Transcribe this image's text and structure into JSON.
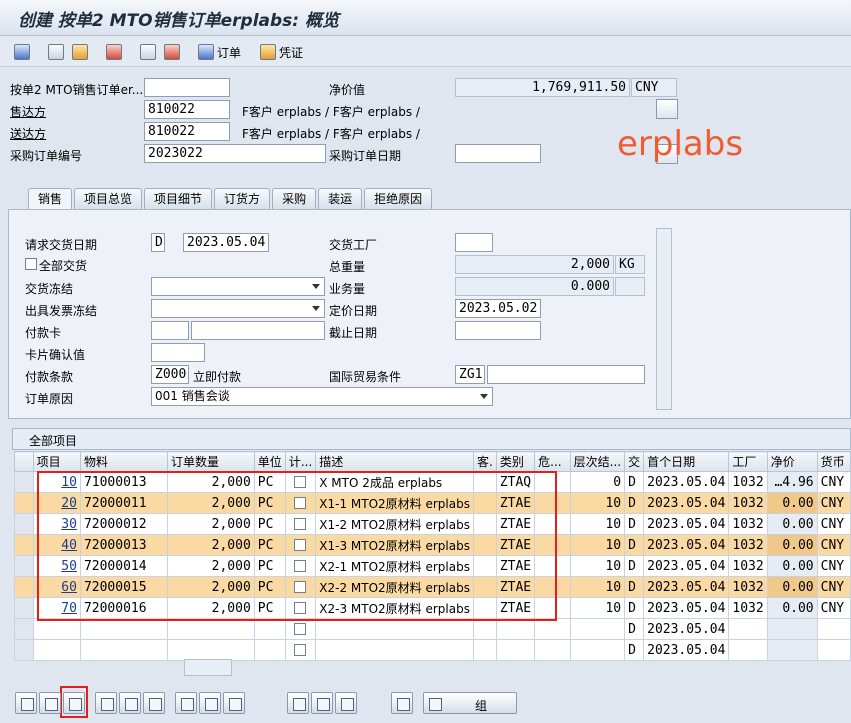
{
  "title": "创建 按单2 MTO销售订单erplabs: 概览",
  "toolbar": {
    "order_label": "订单",
    "voucher_label": "凭证"
  },
  "header": {
    "order_type_label": "按单2 MTO销售订单er...",
    "order_type_value": "",
    "net_value_label": "净价值",
    "net_value": "1,769,911.50",
    "currency": "CNY",
    "sold_to_label": "售达方",
    "sold_to_value": "810022",
    "sold_to_desc": "F客户 erplabs / F客户 erplabs /",
    "ship_to_label": "送达方",
    "ship_to_value": "810022",
    "ship_to_desc": "F客户 erplabs / F客户 erplabs /",
    "po_label": "采购订单编号",
    "po_value": "2023022",
    "po_date_label": "采购订单日期",
    "po_date_value": ""
  },
  "watermark": "erplabs",
  "tabs": [
    "销售",
    "项目总览",
    "项目细节",
    "订货方",
    "采购",
    "装运",
    "拒绝原因"
  ],
  "sales": {
    "req_delivery_label": "请求交货日期",
    "req_delivery_type": "D",
    "req_delivery_date": "2023.05.04",
    "delivery_plant_label": "交货工厂",
    "complete_delivery_label": "全部交货",
    "total_weight_label": "总重量",
    "total_weight": "2,000",
    "weight_unit": "KG",
    "delivery_block_label": "交货冻结",
    "volume_label": "业务量",
    "volume": "0.000",
    "billing_block_label": "出具发票冻结",
    "pricing_date_label": "定价日期",
    "pricing_date": "2023.05.02",
    "payment_card_label": "付款卡",
    "expiry_label": "截止日期",
    "card_verif_label": "卡片确认值",
    "payment_terms_label": "付款条款",
    "payment_terms_code": "Z000",
    "payment_terms_text": "立即付款",
    "incoterms_label": "国际贸易条件",
    "incoterms_code": "ZG1",
    "order_reason_label": "订单原因",
    "order_reason_value": "001 销售会谈"
  },
  "grid": {
    "title": "全部项目",
    "columns": [
      "项目",
      "物料",
      "订单数量",
      "单位",
      "计...",
      "描述",
      "客.",
      "类别",
      "危...",
      "层次结...",
      "交",
      "首个日期",
      "工厂",
      "净价",
      "货币"
    ],
    "rows": [
      {
        "item": "10",
        "material": "71000013",
        "qty": "2,000",
        "unit": "PC",
        "desc": "X MTO 2成品 erplabs",
        "cat": "ZTAQ",
        "hier": "0",
        "d": "D",
        "date": "2023.05.04",
        "plant": "1032",
        "price": "…4.96",
        "cur": "CNY"
      },
      {
        "item": "20",
        "material": "72000011",
        "qty": "2,000",
        "unit": "PC",
        "desc": "X1-1 MTO2原材料 erplabs",
        "cat": "ZTAE",
        "hier": "10",
        "d": "D",
        "date": "2023.05.04",
        "plant": "1032",
        "price": "0.00",
        "cur": "CNY"
      },
      {
        "item": "30",
        "material": "72000012",
        "qty": "2,000",
        "unit": "PC",
        "desc": "X1-2 MTO2原材料 erplabs",
        "cat": "ZTAE",
        "hier": "10",
        "d": "D",
        "date": "2023.05.04",
        "plant": "1032",
        "price": "0.00",
        "cur": "CNY"
      },
      {
        "item": "40",
        "material": "72000013",
        "qty": "2,000",
        "unit": "PC",
        "desc": "X1-3 MTO2原材料 erplabs",
        "cat": "ZTAE",
        "hier": "10",
        "d": "D",
        "date": "2023.05.04",
        "plant": "1032",
        "price": "0.00",
        "cur": "CNY"
      },
      {
        "item": "50",
        "material": "72000014",
        "qty": "2,000",
        "unit": "PC",
        "desc": "X2-1 MTO2原材料 erplabs",
        "cat": "ZTAE",
        "hier": "10",
        "d": "D",
        "date": "2023.05.04",
        "plant": "1032",
        "price": "0.00",
        "cur": "CNY"
      },
      {
        "item": "60",
        "material": "72000015",
        "qty": "2,000",
        "unit": "PC",
        "desc": "X2-2 MTO2原材料 erplabs",
        "cat": "ZTAE",
        "hier": "10",
        "d": "D",
        "date": "2023.05.04",
        "plant": "1032",
        "price": "0.00",
        "cur": "CNY"
      },
      {
        "item": "70",
        "material": "72000016",
        "qty": "2,000",
        "unit": "PC",
        "desc": "X2-3 MTO2原材料 erplabs",
        "cat": "ZTAE",
        "hier": "10",
        "d": "D",
        "date": "2023.05.04",
        "plant": "1032",
        "price": "0.00",
        "cur": "CNY"
      }
    ],
    "empty_rows": [
      {
        "d": "D",
        "date": "2023.05.04"
      },
      {
        "d": "D",
        "date": "2023.05.04"
      }
    ]
  },
  "bottom": {
    "group_label": "组"
  },
  "colors": {
    "highlight": "#fbd9a2",
    "annotation": "#e0201b",
    "watermark": "#f25b32"
  }
}
